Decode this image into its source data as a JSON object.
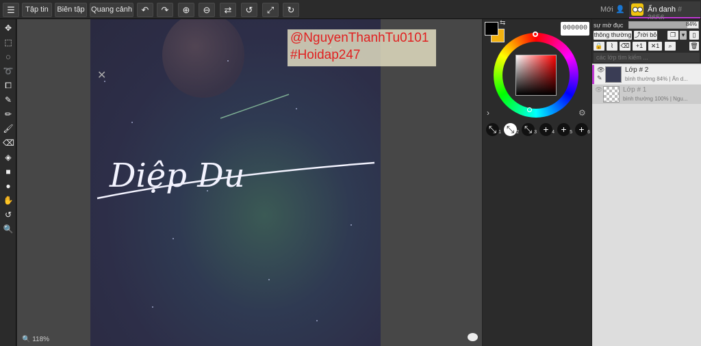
{
  "topbar": {
    "menu_icon": "hamburger-icon",
    "file_label": "Tập tin",
    "edit_label": "Biên tập",
    "view_label": "Quang cảnh",
    "new_label": "Mới",
    "user_name": "Ẩn danh",
    "user_id": "# 3656"
  },
  "canvas": {
    "zoom": "118%",
    "watermark_line1": "@NguyenThanhTu0101",
    "watermark_line2": "#Hoidap247",
    "signature_text": "Diệp Du"
  },
  "color": {
    "foreground": "#000000",
    "background": "#f1b00f",
    "hex_value": "000000"
  },
  "brushes": [
    "1",
    "2",
    "3",
    "4",
    "5",
    "6"
  ],
  "layers_panel": {
    "opacity_label": "sự mờ đục",
    "opacity_value": "84%",
    "opacity_fraction": 0.84,
    "blend_mode": "thông thường",
    "discard_label": "rời bỏ",
    "search_placeholder": "các lớp tìm kiếm ...",
    "layers": [
      {
        "name": "Lớp # 2",
        "meta": "bình thường  84%  |  Ẩn d..."
      },
      {
        "name": "Lớp # 1",
        "meta": "bình thường  100%  |  Ngu..."
      }
    ]
  }
}
